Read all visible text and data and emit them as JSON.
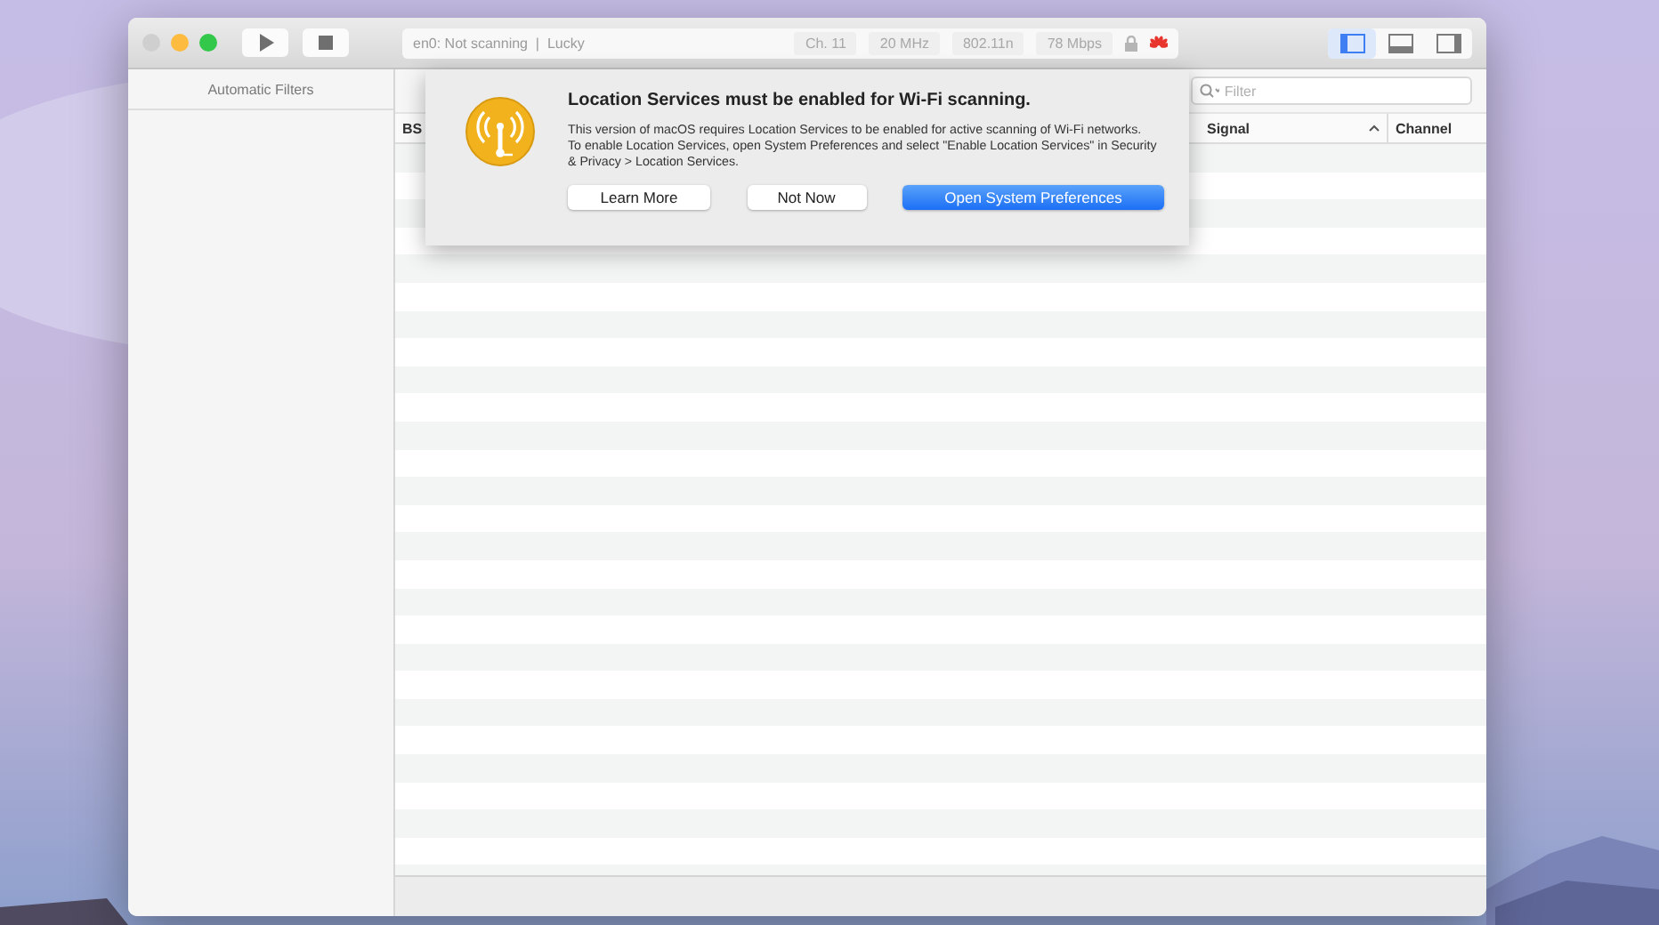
{
  "window": {
    "traffic_lights": [
      {
        "kind": "close",
        "enabled": false
      },
      {
        "kind": "minimize",
        "enabled": true
      },
      {
        "kind": "zoom",
        "enabled": true
      }
    ]
  },
  "toolbar": {
    "controls": [
      {
        "kind": "play"
      },
      {
        "kind": "stop"
      }
    ],
    "status": {
      "text": "en0: Not scanning  |  Lucky",
      "chips": [
        "Ch. 11",
        "20 MHz",
        "802.11n",
        "78 Mbps"
      ]
    },
    "view_toggles": [
      {
        "kind": "left",
        "selected": true
      },
      {
        "kind": "bottom",
        "selected": false
      },
      {
        "kind": "right",
        "selected": false
      }
    ]
  },
  "sidebar": {
    "header": "Automatic Filters"
  },
  "filter": {
    "placeholder": "Filter"
  },
  "table": {
    "columns": [
      {
        "label": "BS",
        "sorted": false
      },
      {
        "label": "Signal",
        "sorted": true
      },
      {
        "label": "Channel",
        "sorted": false
      }
    ]
  },
  "dialog": {
    "title": "Location Services must be enabled for Wi-Fi scanning.",
    "message": "This version of macOS requires Location Services to be enabled for active scanning of Wi-Fi networks. To enable Location Services, open System Preferences and select \"Enable Location Services\" in Security & Privacy > Location Services.",
    "buttons": [
      {
        "label": "Learn More",
        "kind": "normal"
      },
      {
        "label": "Not Now",
        "kind": "normal"
      },
      {
        "label": "Open System Preferences",
        "kind": "default"
      }
    ]
  }
}
